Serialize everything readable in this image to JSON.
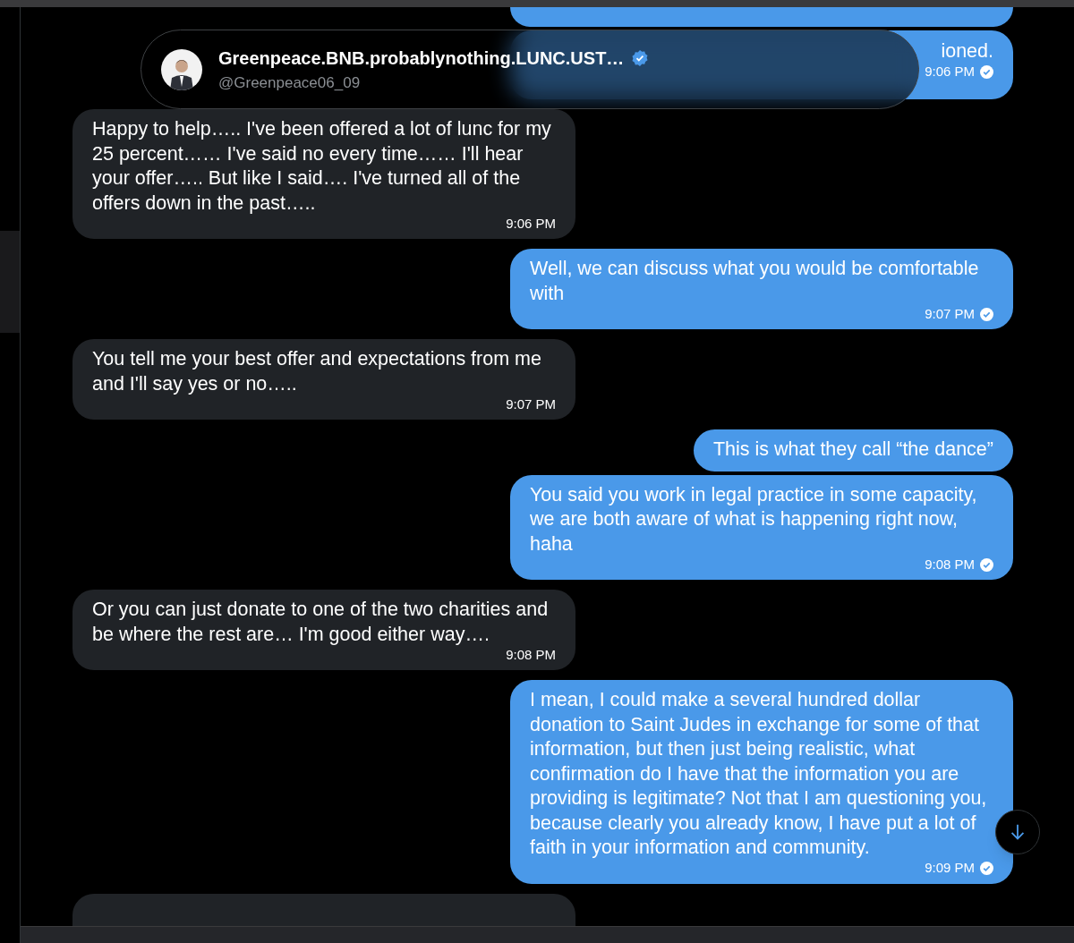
{
  "header": {
    "name": "Greenpeace.BNB.probablynothing.LUNC.UST…",
    "handle": "@Greenpeace06_09",
    "verified": true
  },
  "messages": [
    {
      "kind": "clipped",
      "text": "ioned.",
      "time": "9:06 PM",
      "read": true
    },
    {
      "kind": "received",
      "text": "Happy to help….. I've been offered a lot of lunc for my 25 percent…… I've said no every time…… I'll hear your offer….. But like I said…. I've turned all of the offers down in the past…..",
      "time": "9:06 PM"
    },
    {
      "kind": "sent",
      "text": "Well, we can discuss what you would be comfortable with",
      "time": "9:07 PM",
      "read": true
    },
    {
      "kind": "received",
      "text": "You tell me your best offer and expectations from me and I'll say yes or no…..",
      "time": "9:07 PM"
    },
    {
      "kind": "sent",
      "text": "This is what they call “the dance”"
    },
    {
      "kind": "sent",
      "text": "You said you work in legal practice in some capacity, we are both aware of what is happening right now, haha",
      "time": "9:08 PM",
      "read": true
    },
    {
      "kind": "received",
      "text": "Or you can just donate to one of the two charities and be where the rest are… I'm good either way….",
      "time": "9:08 PM"
    },
    {
      "kind": "sent",
      "text": "I mean, I could make a several hundred dollar donation to Saint Judes in exchange for some of that information, but then just being realistic, what confirmation do I have that the information you are providing is legitimate? Not that I am questioning you, because clearly you already know, I have put a lot of faith in your information and community.",
      "time": "9:09 PM",
      "read": true
    }
  ]
}
